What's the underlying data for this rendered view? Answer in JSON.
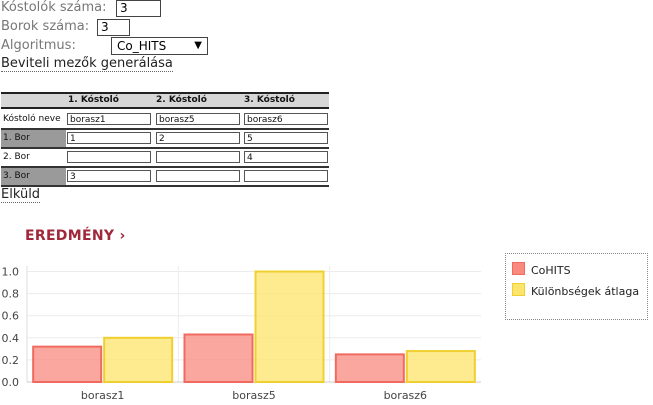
{
  "form": {
    "tasters_label": "Kóstolók száma:",
    "tasters_value": "3",
    "wines_label": "Borok száma:",
    "wines_value": "3",
    "algorithm_label": "Algoritmus:",
    "algorithm_value": "Co_HITS",
    "generate_link": "Beviteli mezők generálása",
    "submit_link": "Elküld"
  },
  "table": {
    "headers": [
      "1. Kóstoló",
      "2. Kóstoló",
      "3. Kóstoló"
    ],
    "name_row_label": "Kóstoló neve",
    "names": [
      "borasz1",
      "borasz5",
      "borasz6"
    ],
    "rows": [
      {
        "label": "1. Bor",
        "values": [
          "1",
          "2",
          "5"
        ]
      },
      {
        "label": "2. Bor",
        "values": [
          "",
          "",
          "4"
        ]
      },
      {
        "label": "3. Bor",
        "values": [
          "3",
          "",
          ""
        ]
      }
    ]
  },
  "result_title": "EREDMÉNY ›",
  "chart_data": {
    "type": "bar",
    "categories": [
      "borasz1",
      "borasz5",
      "borasz6"
    ],
    "series": [
      {
        "name": "CoHITS",
        "values": [
          0.32,
          0.43,
          0.25
        ],
        "color": "#f88a80",
        "stroke": "#f06a60"
      },
      {
        "name": "Különbségek átlaga",
        "values": [
          0.4,
          1.0,
          0.28
        ],
        "color": "#fde46a",
        "stroke": "#f0d030"
      }
    ],
    "yticks": [
      "0.0",
      "0.2",
      "0.4",
      "0.6",
      "0.8",
      "1.0"
    ],
    "ylim": [
      0,
      1.05
    ],
    "legend_position": "top-right",
    "grid": true
  }
}
